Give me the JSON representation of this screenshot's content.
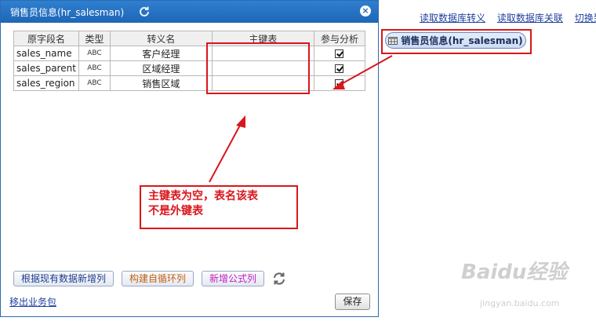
{
  "workspace": {
    "links": [
      "读取数据库转义",
      "读取数据库关联",
      "切换到"
    ],
    "node_label": "销售员信息(hr_salesman)"
  },
  "dialog": {
    "title": "销售员信息(hr_salesman)",
    "close_label": "×",
    "columns": [
      "原字段名",
      "类型",
      "转义名",
      "主键表",
      "参与分析"
    ],
    "rows": [
      {
        "name": "sales_name",
        "type": "ABC",
        "alias": "客户经理",
        "pk": "",
        "analyze": true
      },
      {
        "name": "sales_parent",
        "type": "ABC",
        "alias": "区域经理",
        "pk": "",
        "analyze": true
      },
      {
        "name": "sales_region",
        "type": "ABC",
        "alias": "销售区域",
        "pk": "",
        "analyze": true
      }
    ],
    "buttons": {
      "add_from_data": "根据现有数据新增列",
      "build_cycle": "构建自循环列",
      "add_formula": "新增公式列"
    },
    "export_link": "移出业务包",
    "save": "保存"
  },
  "annotation": {
    "note_line1": "主键表为空，表名该表",
    "note_line2": "不是外键表",
    "color": "#d9161c"
  },
  "watermark": {
    "brand": "Baidu经验",
    "url": "jingyan.baidu.com"
  }
}
